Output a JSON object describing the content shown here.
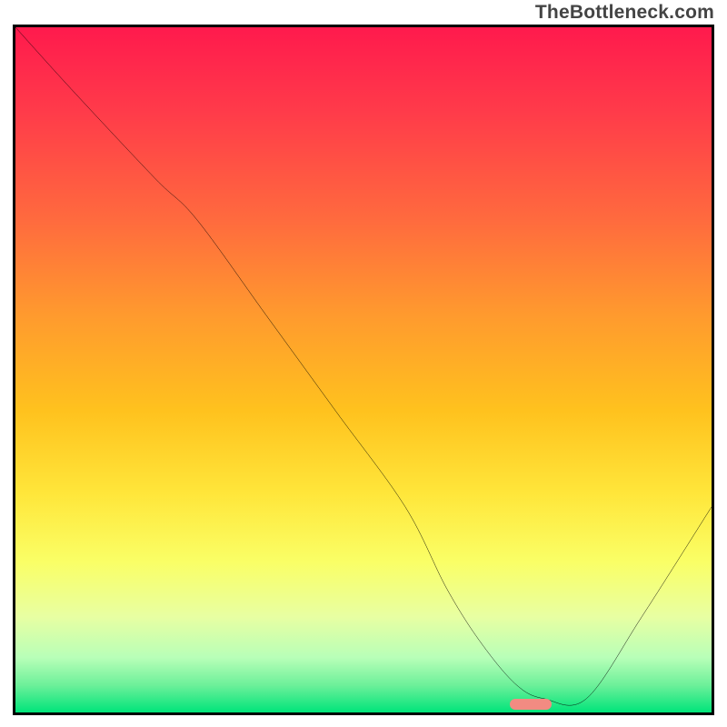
{
  "watermark": "TheBottleneck.com",
  "chart_data": {
    "type": "line",
    "title": "",
    "xlabel": "",
    "ylabel": "",
    "xlim": [
      0,
      100
    ],
    "ylim": [
      0,
      100
    ],
    "grid": false,
    "series": [
      {
        "name": "curve",
        "x": [
          0,
          8,
          20,
          26,
          36,
          46,
          56,
          62,
          67,
          72,
          76,
          82,
          90,
          100
        ],
        "y": [
          100,
          91,
          78,
          72,
          58,
          44,
          30,
          18,
          10,
          4,
          2,
          2,
          14,
          30
        ]
      }
    ],
    "marker": {
      "x": 74,
      "y": 1.2,
      "shape": "pill",
      "color": "#f28b82"
    },
    "background": {
      "type": "vertical-gradient",
      "stops": [
        {
          "pos": 0,
          "color": "#ff1a4d"
        },
        {
          "pos": 28,
          "color": "#ff6a3e"
        },
        {
          "pos": 56,
          "color": "#ffc21e"
        },
        {
          "pos": 78,
          "color": "#faff66"
        },
        {
          "pos": 96,
          "color": "#6df09a"
        },
        {
          "pos": 100,
          "color": "#00e47a"
        }
      ]
    }
  }
}
